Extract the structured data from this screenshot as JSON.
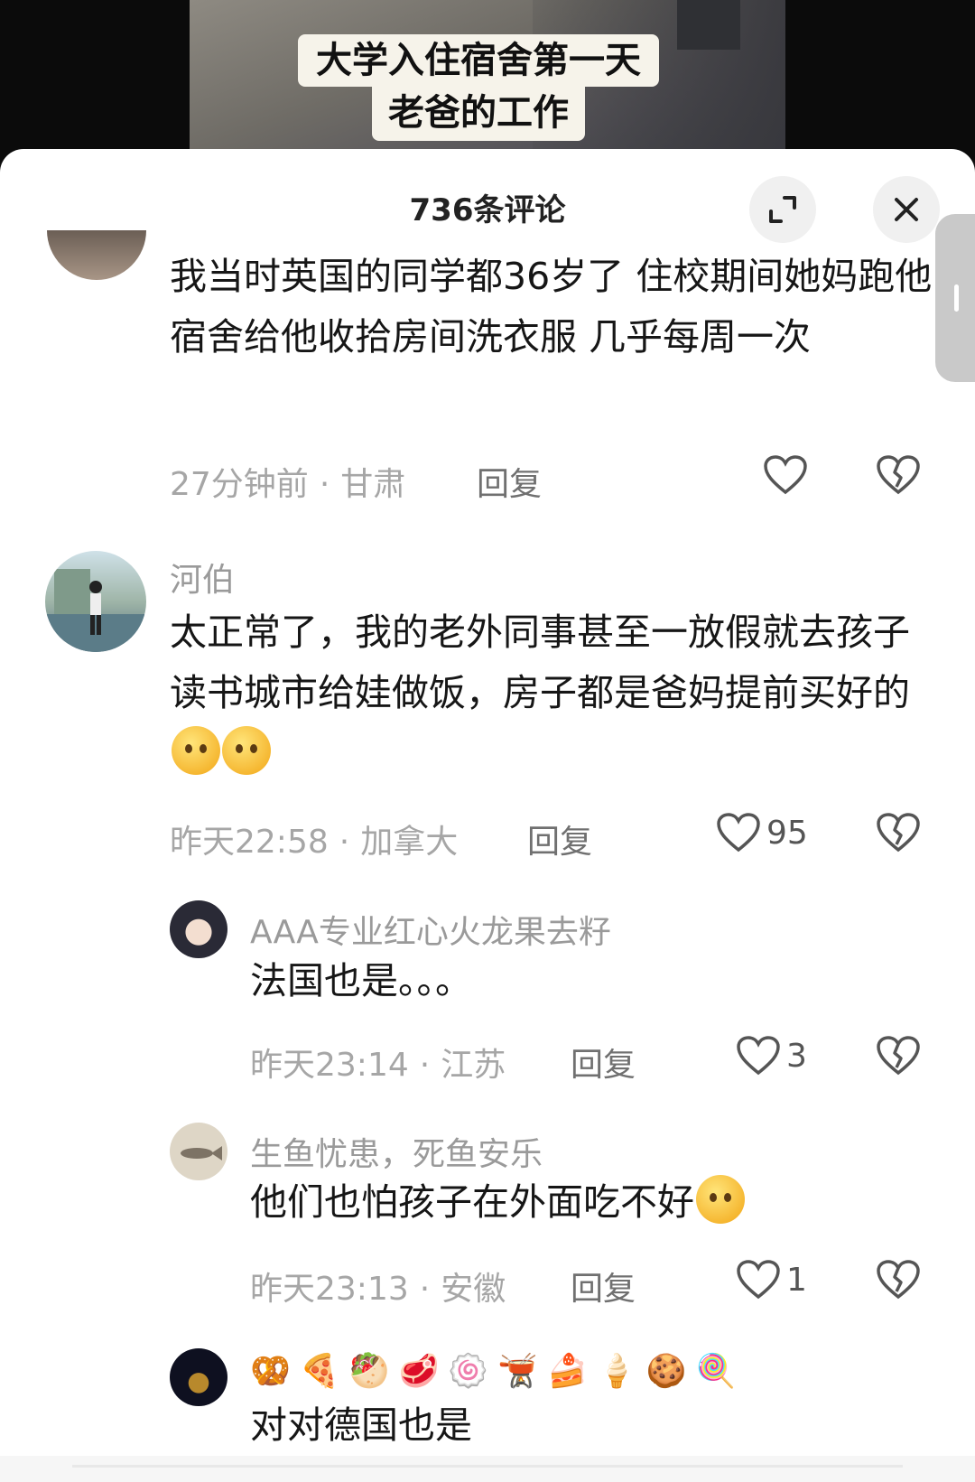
{
  "video": {
    "caption_line1": "大学入住宿舍第一天",
    "caption_line2": "老爸的工作"
  },
  "sheet": {
    "title": "736条评论"
  },
  "comments": [
    {
      "text": "我当时英国的同学都36岁了 住校期间她妈跑他宿舍给他收拾房间洗衣服 几乎每周一次",
      "time": "27分钟前",
      "location": "甘肃",
      "reply_label": "回复",
      "likes": ""
    },
    {
      "username": "河伯",
      "text": "太正常了，我的老外同事甚至一放假就去孩子读书城市给娃做饭，房子都是爸妈提前买好的",
      "time": "昨天22:58",
      "location": "加拿大",
      "reply_label": "回复",
      "likes": "95"
    }
  ],
  "replies": [
    {
      "username": "AAA专业红心火龙果去籽",
      "text": "法国也是。。。",
      "time": "昨天23:14",
      "location": "江苏",
      "reply_label": "回复",
      "likes": "3"
    },
    {
      "username": "生鱼忧患，死鱼安乐",
      "text": "他们也怕孩子在外面吃不好",
      "time": "昨天23:13",
      "location": "安徽",
      "reply_label": "回复",
      "likes": "1"
    },
    {
      "username_stickers": [
        "🥨",
        "🍕",
        "🥙",
        "🥩",
        "🍥",
        "🫕",
        "🍰",
        "🍦",
        "🍪",
        "🍭"
      ],
      "text": "对对德国也是"
    }
  ],
  "separator": "·",
  "colors": {
    "accent_text": "#161616",
    "meta_text": "#a6a6a6",
    "sheet_bg": "#ffffff"
  },
  "icons": [
    "expand-icon",
    "close-icon",
    "heart-icon",
    "heart-broken-icon"
  ]
}
